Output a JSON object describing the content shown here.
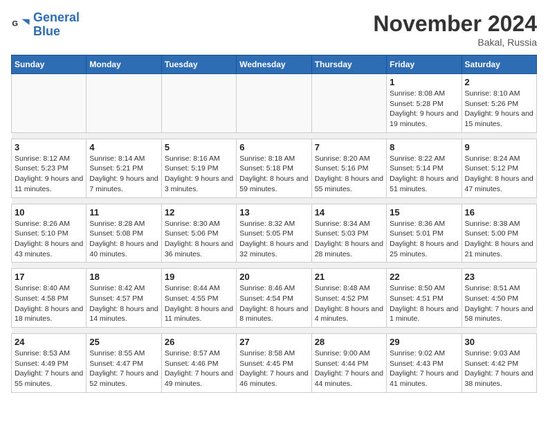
{
  "logo": {
    "text_general": "General",
    "text_blue": "Blue"
  },
  "title": "November 2024",
  "location": "Bakal, Russia",
  "days_of_week": [
    "Sunday",
    "Monday",
    "Tuesday",
    "Wednesday",
    "Thursday",
    "Friday",
    "Saturday"
  ],
  "weeks": [
    [
      {
        "day": "",
        "info": ""
      },
      {
        "day": "",
        "info": ""
      },
      {
        "day": "",
        "info": ""
      },
      {
        "day": "",
        "info": ""
      },
      {
        "day": "",
        "info": ""
      },
      {
        "day": "1",
        "info": "Sunrise: 8:08 AM\nSunset: 5:28 PM\nDaylight: 9 hours and 19 minutes."
      },
      {
        "day": "2",
        "info": "Sunrise: 8:10 AM\nSunset: 5:26 PM\nDaylight: 9 hours and 15 minutes."
      }
    ],
    [
      {
        "day": "3",
        "info": "Sunrise: 8:12 AM\nSunset: 5:23 PM\nDaylight: 9 hours and 11 minutes."
      },
      {
        "day": "4",
        "info": "Sunrise: 8:14 AM\nSunset: 5:21 PM\nDaylight: 9 hours and 7 minutes."
      },
      {
        "day": "5",
        "info": "Sunrise: 8:16 AM\nSunset: 5:19 PM\nDaylight: 9 hours and 3 minutes."
      },
      {
        "day": "6",
        "info": "Sunrise: 8:18 AM\nSunset: 5:18 PM\nDaylight: 8 hours and 59 minutes."
      },
      {
        "day": "7",
        "info": "Sunrise: 8:20 AM\nSunset: 5:16 PM\nDaylight: 8 hours and 55 minutes."
      },
      {
        "day": "8",
        "info": "Sunrise: 8:22 AM\nSunset: 5:14 PM\nDaylight: 8 hours and 51 minutes."
      },
      {
        "day": "9",
        "info": "Sunrise: 8:24 AM\nSunset: 5:12 PM\nDaylight: 8 hours and 47 minutes."
      }
    ],
    [
      {
        "day": "10",
        "info": "Sunrise: 8:26 AM\nSunset: 5:10 PM\nDaylight: 8 hours and 43 minutes."
      },
      {
        "day": "11",
        "info": "Sunrise: 8:28 AM\nSunset: 5:08 PM\nDaylight: 8 hours and 40 minutes."
      },
      {
        "day": "12",
        "info": "Sunrise: 8:30 AM\nSunset: 5:06 PM\nDaylight: 8 hours and 36 minutes."
      },
      {
        "day": "13",
        "info": "Sunrise: 8:32 AM\nSunset: 5:05 PM\nDaylight: 8 hours and 32 minutes."
      },
      {
        "day": "14",
        "info": "Sunrise: 8:34 AM\nSunset: 5:03 PM\nDaylight: 8 hours and 28 minutes."
      },
      {
        "day": "15",
        "info": "Sunrise: 8:36 AM\nSunset: 5:01 PM\nDaylight: 8 hours and 25 minutes."
      },
      {
        "day": "16",
        "info": "Sunrise: 8:38 AM\nSunset: 5:00 PM\nDaylight: 8 hours and 21 minutes."
      }
    ],
    [
      {
        "day": "17",
        "info": "Sunrise: 8:40 AM\nSunset: 4:58 PM\nDaylight: 8 hours and 18 minutes."
      },
      {
        "day": "18",
        "info": "Sunrise: 8:42 AM\nSunset: 4:57 PM\nDaylight: 8 hours and 14 minutes."
      },
      {
        "day": "19",
        "info": "Sunrise: 8:44 AM\nSunset: 4:55 PM\nDaylight: 8 hours and 11 minutes."
      },
      {
        "day": "20",
        "info": "Sunrise: 8:46 AM\nSunset: 4:54 PM\nDaylight: 8 hours and 8 minutes."
      },
      {
        "day": "21",
        "info": "Sunrise: 8:48 AM\nSunset: 4:52 PM\nDaylight: 8 hours and 4 minutes."
      },
      {
        "day": "22",
        "info": "Sunrise: 8:50 AM\nSunset: 4:51 PM\nDaylight: 8 hours and 1 minute."
      },
      {
        "day": "23",
        "info": "Sunrise: 8:51 AM\nSunset: 4:50 PM\nDaylight: 7 hours and 58 minutes."
      }
    ],
    [
      {
        "day": "24",
        "info": "Sunrise: 8:53 AM\nSunset: 4:49 PM\nDaylight: 7 hours and 55 minutes."
      },
      {
        "day": "25",
        "info": "Sunrise: 8:55 AM\nSunset: 4:47 PM\nDaylight: 7 hours and 52 minutes."
      },
      {
        "day": "26",
        "info": "Sunrise: 8:57 AM\nSunset: 4:46 PM\nDaylight: 7 hours and 49 minutes."
      },
      {
        "day": "27",
        "info": "Sunrise: 8:58 AM\nSunset: 4:45 PM\nDaylight: 7 hours and 46 minutes."
      },
      {
        "day": "28",
        "info": "Sunrise: 9:00 AM\nSunset: 4:44 PM\nDaylight: 7 hours and 44 minutes."
      },
      {
        "day": "29",
        "info": "Sunrise: 9:02 AM\nSunset: 4:43 PM\nDaylight: 7 hours and 41 minutes."
      },
      {
        "day": "30",
        "info": "Sunrise: 9:03 AM\nSunset: 4:42 PM\nDaylight: 7 hours and 38 minutes."
      }
    ]
  ]
}
